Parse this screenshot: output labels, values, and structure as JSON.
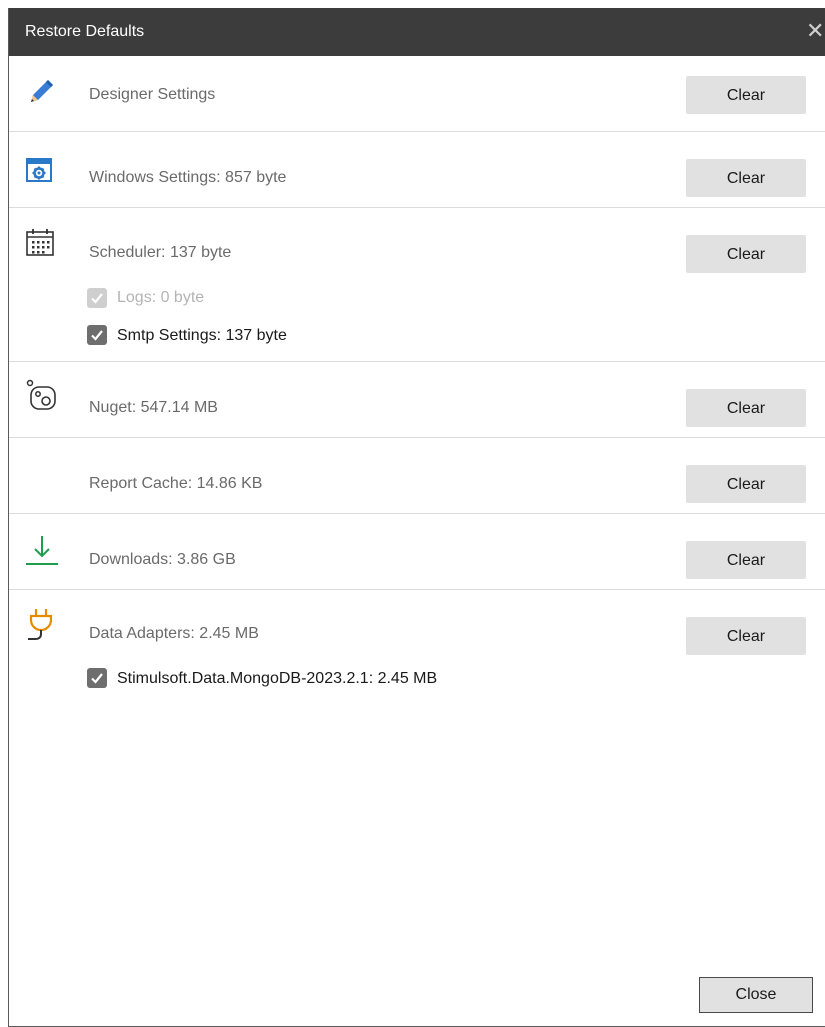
{
  "window": {
    "title": "Restore Defaults",
    "close_glyph": "✕"
  },
  "rows": [
    {
      "icon": "pencil-icon",
      "label": "Designer Settings",
      "button": "Clear"
    },
    {
      "icon": "window-settings-icon",
      "label": "Windows Settings: 857 byte",
      "button": "Clear"
    },
    {
      "icon": "calendar-icon",
      "label": "Scheduler: 137 byte",
      "button": "Clear",
      "subitems": [
        {
          "label": "Logs: 0 byte",
          "checked": true,
          "disabled": true
        },
        {
          "label": "Smtp Settings: 137 byte",
          "checked": true,
          "disabled": false
        }
      ]
    },
    {
      "icon": "nuget-icon",
      "label": "Nuget: 547.14 MB",
      "button": "Clear"
    },
    {
      "icon": "",
      "label": "Report Cache: 14.86 KB",
      "button": "Clear"
    },
    {
      "icon": "download-icon",
      "label": "Downloads: 3.86 GB",
      "button": "Clear"
    },
    {
      "icon": "plug-icon",
      "label": "Data Adapters: 2.45 MB",
      "button": "Clear",
      "subitems": [
        {
          "label": "Stimulsoft.Data.MongoDB-2023.2.1: 2.45 MB",
          "checked": true,
          "disabled": false
        }
      ]
    }
  ],
  "footer": {
    "close_label": "Close"
  },
  "colors": {
    "titlebar": "#3c3c3c",
    "pencil": "#3a7bd5",
    "download": "#1e9e4a",
    "plug": "#e68a00",
    "button": "#e1e1e1"
  }
}
